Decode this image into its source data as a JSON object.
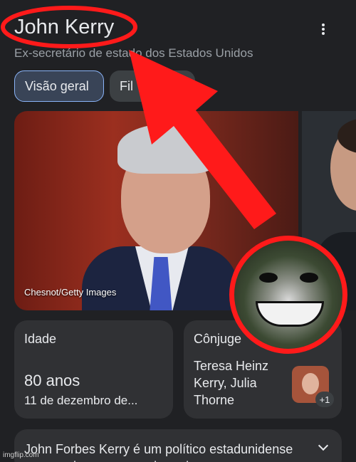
{
  "header": {
    "title": "John Kerry",
    "subtitle": "Ex-secretário de estado dos Estados Unidos"
  },
  "tabs": [
    {
      "label": "Visão geral",
      "active": true
    },
    {
      "label": "Fil",
      "active": false
    }
  ],
  "photo": {
    "credit": "Chesnot/Getty Images"
  },
  "cards": {
    "age": {
      "label": "Idade",
      "value": "80 anos",
      "sub": "11 de dezembro de..."
    },
    "spouse": {
      "label": "Cônjuge",
      "value": "Teresa Heinz Kerry, Julia Thorne",
      "more": "+1"
    }
  },
  "description": {
    "text": "John Forbes Kerry é um político estadunidense que serviu como senador pelo"
  },
  "overlay": {
    "accent_color": "#ff1a1a",
    "watermark": "imgflip.com"
  }
}
